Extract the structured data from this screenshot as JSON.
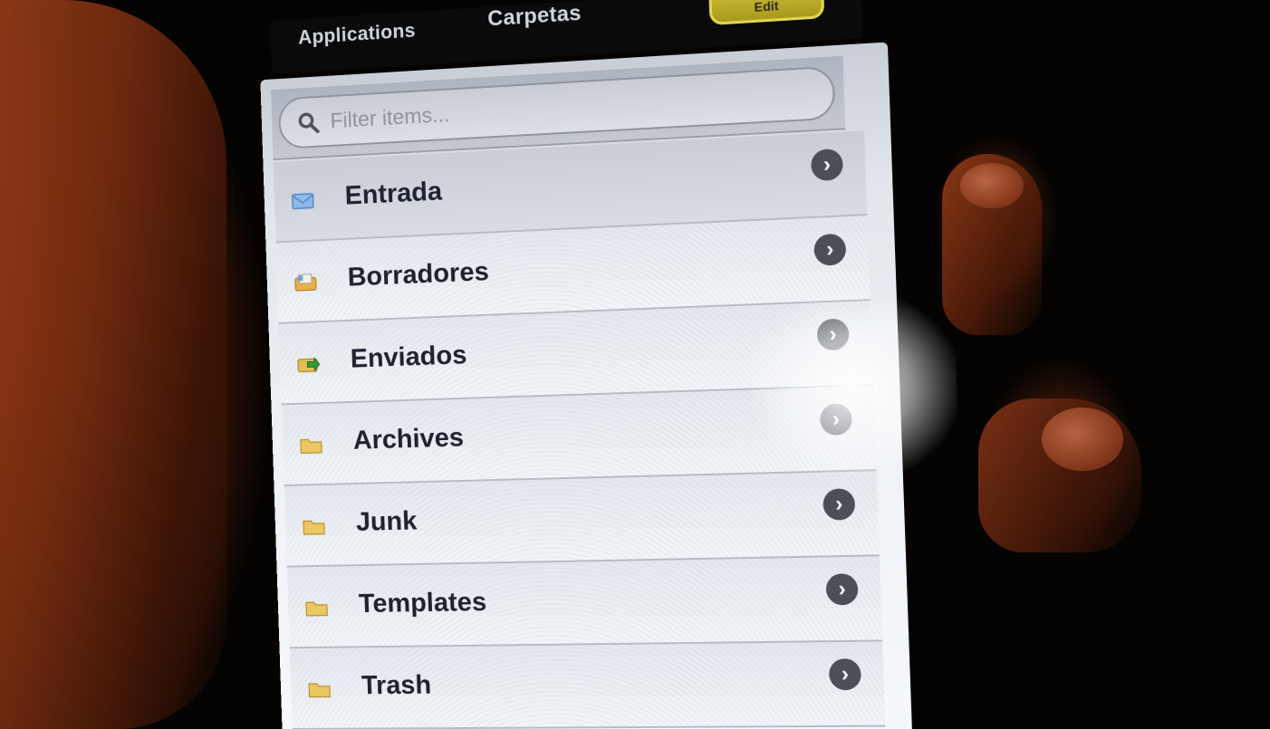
{
  "topbar": {
    "tabs": [
      "Applications",
      "Carpetas"
    ],
    "edit_label": "Edit"
  },
  "search": {
    "placeholder": "Filter items...",
    "icon": "search-icon"
  },
  "folders": [
    {
      "label": "Entrada",
      "icon": "inbox-envelope-icon",
      "icon_color": "#6fa3de"
    },
    {
      "label": "Borradores",
      "icon": "drafts-folder-icon",
      "icon_color": "#e2a33c"
    },
    {
      "label": "Enviados",
      "icon": "sent-folder-icon",
      "icon_color": "#d9b34a"
    },
    {
      "label": "Archives",
      "icon": "folder-icon",
      "icon_color": "#e3bd55"
    },
    {
      "label": "Junk",
      "icon": "folder-icon",
      "icon_color": "#e3bd55"
    },
    {
      "label": "Templates",
      "icon": "folder-icon",
      "icon_color": "#e3bd55"
    },
    {
      "label": "Trash",
      "icon": "folder-icon",
      "icon_color": "#e3bd55"
    }
  ],
  "colors": {
    "accent_button": "#d8c640",
    "list_background": "#eef1f5",
    "chevron_badge": "#4a4f58"
  }
}
